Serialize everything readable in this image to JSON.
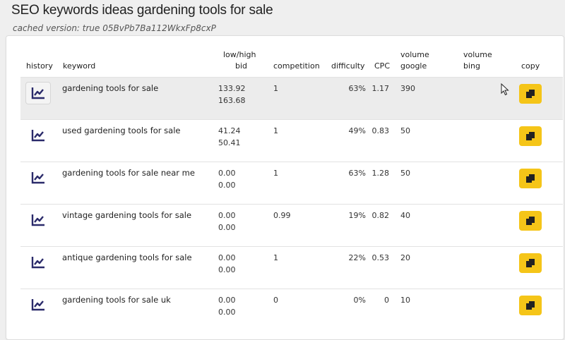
{
  "page": {
    "title": "SEO keywords ideas gardening tools for sale",
    "subtitle": "cached version: true 05BvPb7Ba112WkxFp8cxP"
  },
  "table": {
    "headers": {
      "history": "history",
      "keyword": "keyword",
      "bid_line1": "low/high",
      "bid_line2": "bid",
      "competition": "competition",
      "difficulty": "difficulty",
      "cpc": "CPC",
      "vg_line1": "volume",
      "vg_line2": "google",
      "vb_line1": "volume",
      "vb_line2": "bing",
      "copy": "copy"
    },
    "rows": [
      {
        "keyword": "gardening tools for sale",
        "bid_low": "133.92",
        "bid_high": "163.68",
        "competition": "1",
        "difficulty": "63%",
        "cpc": "1.17",
        "volume_google": "390",
        "volume_bing": ""
      },
      {
        "keyword": "used gardening tools for sale",
        "bid_low": "41.24",
        "bid_high": "50.41",
        "competition": "1",
        "difficulty": "49%",
        "cpc": "0.83",
        "volume_google": "50",
        "volume_bing": ""
      },
      {
        "keyword": "gardening tools for sale near me",
        "bid_low": "0.00",
        "bid_high": "0.00",
        "competition": "1",
        "difficulty": "63%",
        "cpc": "1.28",
        "volume_google": "50",
        "volume_bing": ""
      },
      {
        "keyword": "vintage gardening tools for sale",
        "bid_low": "0.00",
        "bid_high": "0.00",
        "competition": "0.99",
        "difficulty": "19%",
        "cpc": "0.82",
        "volume_google": "40",
        "volume_bing": ""
      },
      {
        "keyword": "antique gardening tools for sale",
        "bid_low": "0.00",
        "bid_high": "0.00",
        "competition": "1",
        "difficulty": "22%",
        "cpc": "0.53",
        "volume_google": "20",
        "volume_bing": ""
      },
      {
        "keyword": "gardening tools for sale uk",
        "bid_low": "0.00",
        "bid_high": "0.00",
        "competition": "0",
        "difficulty": "0%",
        "cpc": "0",
        "volume_google": "10",
        "volume_bing": ""
      }
    ]
  },
  "icons": {
    "history": "chart-line-icon",
    "copy": "copy-icon",
    "cursor": "mouse-cursor-icon"
  },
  "colors": {
    "accent": "#f5c518",
    "icon": "#2a2a6a",
    "highlight_row": "#ececec"
  }
}
